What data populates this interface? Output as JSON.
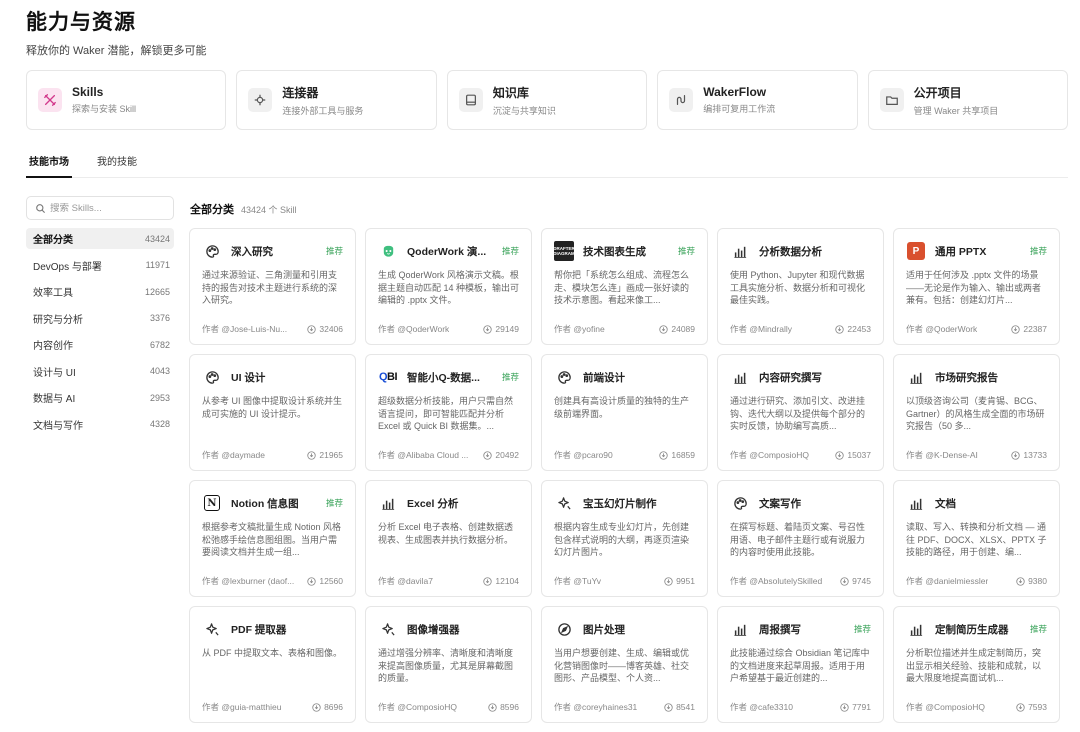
{
  "header": {
    "title": "能力与资源",
    "subtitle": "释放你的 Waker 潜能，解锁更多可能"
  },
  "capabilities": [
    {
      "title": "Skills",
      "desc": "探索与安装 Skill",
      "icon": "tools-icon"
    },
    {
      "title": "连接器",
      "desc": "连接外部工具与服务",
      "icon": "connector-icon"
    },
    {
      "title": "知识库",
      "desc": "沉淀与共享知识",
      "icon": "knowledge-icon"
    },
    {
      "title": "WakerFlow",
      "desc": "编排可复用工作流",
      "icon": "flow-icon"
    },
    {
      "title": "公开项目",
      "desc": "管理 Waker 共享项目",
      "icon": "folder-icon"
    }
  ],
  "tabs": {
    "market": "技能市场",
    "mine": "我的技能"
  },
  "search": {
    "placeholder": "搜索 Skills..."
  },
  "categories": [
    {
      "label": "全部分类",
      "count": "43424"
    },
    {
      "label": "DevOps 与部署",
      "count": "11971"
    },
    {
      "label": "效率工具",
      "count": "12665"
    },
    {
      "label": "研究与分析",
      "count": "3376"
    },
    {
      "label": "内容创作",
      "count": "6782"
    },
    {
      "label": "设计与 UI",
      "count": "4043"
    },
    {
      "label": "数据与 AI",
      "count": "2953"
    },
    {
      "label": "文档与写作",
      "count": "4328"
    }
  ],
  "section": {
    "title": "全部分类",
    "count": "43424 个 Skill"
  },
  "badge_text": {
    "dark": "DRAFTER DIAGRAM",
    "ppt": "P",
    "qbi_q": "Q",
    "qbi_bi": "BI",
    "notion": "N"
  },
  "skills": [
    {
      "title": "深入研究",
      "tag": "推荐",
      "desc": "通过来源验证、三角测量和引用支持的报告对技术主题进行系统的深入研究。",
      "author": "作者 @Jose-Luis-Nu...",
      "downloads": "32406",
      "icon": "palette-icon"
    },
    {
      "title": "QoderWork 演...",
      "tag": "推荐",
      "desc": "生成 QoderWork 风格演示文稿。根据主题自动匹配 14 种模板，输出可编辑的 .pptx 文件。",
      "author": "作者 @QoderWork",
      "downloads": "29149",
      "icon": "qoder-icon"
    },
    {
      "title": "技术图表生成",
      "tag": "推荐",
      "desc": "帮你把「系统怎么组成、流程怎么走、模块怎么连」画成一张好读的技术示意图。看起来像工...",
      "author": "作者 @yofine",
      "downloads": "24089",
      "icon": "diagram-icon"
    },
    {
      "title": "分析数据分析",
      "tag": "",
      "desc": "使用 Python、Jupyter 和现代数据工具实施分析、数据分析和可视化最佳实践。",
      "author": "作者 @Mindrally",
      "downloads": "22453",
      "icon": "bar-chart-icon"
    },
    {
      "title": "通用 PPTX",
      "tag": "推荐",
      "desc": "适用于任何涉及 .pptx 文件的场景——无论是作为输入、输出或两者兼有。包括：创建幻灯片...",
      "author": "作者 @QoderWork",
      "downloads": "22387",
      "icon": "ppt-icon"
    },
    {
      "title": "UI 设计",
      "tag": "",
      "desc": "从参考 UI 图像中提取设计系统并生成可实施的 UI 设计提示。",
      "author": "作者 @daymade",
      "downloads": "21965",
      "icon": "palette-icon"
    },
    {
      "title": "智能小Q-数据...",
      "tag": "推荐",
      "desc": "超级数据分析技能，用户只需自然语言提问，即可智能匹配并分析 Excel 或 Quick BI 数据集。...",
      "author": "作者 @Alibaba Cloud ...",
      "downloads": "20492",
      "icon": "qbi-icon"
    },
    {
      "title": "前端设计",
      "tag": "",
      "desc": "创建具有高设计质量的独特的生产级前端界面。",
      "author": "作者 @pcaro90",
      "downloads": "16859",
      "icon": "palette-icon"
    },
    {
      "title": "内容研究撰写",
      "tag": "",
      "desc": "通过进行研究、添加引文、改进挂钩、迭代大纲以及提供每个部分的实时反馈，协助编写高质...",
      "author": "作者 @ComposioHQ",
      "downloads": "15037",
      "icon": "bar-chart-icon"
    },
    {
      "title": "市场研究报告",
      "tag": "",
      "desc": "以顶级咨询公司（麦肯锡、BCG、Gartner）的风格生成全面的市场研究报告（50 多...",
      "author": "作者 @K-Dense-AI",
      "downloads": "13733",
      "icon": "bar-chart-icon"
    },
    {
      "title": "Notion 信息图",
      "tag": "推荐",
      "desc": "根据参考文稿批量生成 Notion 风格松弛感手绘信息图组图。当用户需要阅读文档并生成一组...",
      "author": "作者 @lexburner (daof...",
      "downloads": "12560",
      "icon": "notion-icon"
    },
    {
      "title": "Excel 分析",
      "tag": "",
      "desc": "分析 Excel 电子表格、创建数据透视表、生成图表并执行数据分析。",
      "author": "作者 @davila7",
      "downloads": "12104",
      "icon": "bar-chart-icon"
    },
    {
      "title": "宝玉幻灯片制作",
      "tag": "",
      "desc": "根据内容生成专业幻灯片，先创建包含样式说明的大纲，再逐页渲染幻灯片图片。",
      "author": "作者 @TuYv",
      "downloads": "9951",
      "icon": "sparkle-icon"
    },
    {
      "title": "文案写作",
      "tag": "",
      "desc": "在撰写标题、着陆页文案、号召性用语、电子邮件主题行或有说服力的内容时使用此技能。",
      "author": "作者 @AbsolutelySkilled",
      "downloads": "9745",
      "icon": "palette-icon"
    },
    {
      "title": "文档",
      "tag": "",
      "desc": "读取、写入、转换和分析文档 — 通往 PDF、DOCX、XLSX、PPTX 子技能的路径，用于创建、编...",
      "author": "作者 @danielmiessler",
      "downloads": "9380",
      "icon": "bar-chart-icon"
    },
    {
      "title": "PDF 提取器",
      "tag": "",
      "desc": "从 PDF 中提取文本、表格和图像。",
      "author": "作者 @guia-matthieu",
      "downloads": "8696",
      "icon": "sparkle-icon"
    },
    {
      "title": "图像增强器",
      "tag": "",
      "desc": "通过增强分辨率、清晰度和清晰度来提高图像质量，尤其是屏幕截图的质量。",
      "author": "作者 @ComposioHQ",
      "downloads": "8596",
      "icon": "sparkle-icon"
    },
    {
      "title": "图片处理",
      "tag": "",
      "desc": "当用户想要创建、生成、编辑或优化营销图像时——博客英雄、社交图形、产品模型、个人资...",
      "author": "作者 @coreyhaines31",
      "downloads": "8541",
      "icon": "compass-icon"
    },
    {
      "title": "周报撰写",
      "tag": "推荐",
      "desc": "此技能通过综合 Obsidian 笔记库中的文档进度来起草周报。适用于用户希望基于最近创建的...",
      "author": "作者 @cafe3310",
      "downloads": "7791",
      "icon": "bar-chart-icon"
    },
    {
      "title": "定制简历生成器",
      "tag": "推荐",
      "desc": "分析职位描述并生成定制简历，突出显示相关经验、技能和成就，以最大限度地提高面试机...",
      "author": "作者 @ComposioHQ",
      "downloads": "7593",
      "icon": "bar-chart-icon"
    }
  ]
}
